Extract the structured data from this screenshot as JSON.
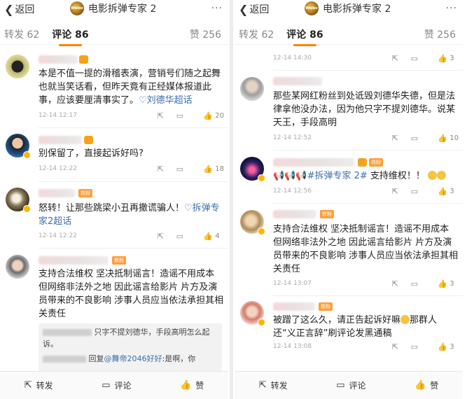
{
  "nav": {
    "back_label": "返回",
    "title": "电影拆弹专家 2"
  },
  "tabs": {
    "repost": "转发 62",
    "comment": "评论 86",
    "likes": "赞 256"
  },
  "bottom_bar": {
    "repost": "转发",
    "comment": "评论",
    "like": "赞"
  },
  "left": {
    "comments": [
      {
        "text": "本是不值一提的滑稽表演，营销号们随之起舞也就当笑话看，但昨天竟有正经媒体报道此事，应该要厘清事实了。",
        "topic": "刘德华超话",
        "time": "12-14 12:17",
        "likes": "20"
      },
      {
        "text": "别保留了，直接起诉好吗?",
        "time": "12-14 12:22",
        "likes": "18"
      },
      {
        "text": "怒转！让那些跳梁小丑再撒谎骗人！",
        "topic": "拆弹专家2超话",
        "time": "12-14 12:22",
        "likes": "4",
        "tag": "铁粉"
      },
      {
        "text": "支持合法维权 坚决抵制谣言！造谣不用成本 但网络非法外之地 因此谣言给影片 片方及演员带来的不良影响 涉事人员应当依法承担其相关责任",
        "tag": "铁粉"
      }
    ],
    "reply1": "只字不提刘德华，手段高明怎么起诉。",
    "reply2_prefix": "回复",
    "reply2_link": "@舞帝2046好好",
    "reply2_text": ":是啊，你"
  },
  "right": {
    "top_time": "12-14 14:30",
    "top_likes": "3",
    "comments": [
      {
        "text": "那些某网红粉丝到处诋毁刘德华失德，但是法律拿他没办法，因为他只字不提刘德华。说某天王，手段高明",
        "time": "12-14 12:52",
        "likes": "10"
      },
      {
        "text_prefix": "📢📢📢",
        "topic": "#拆弹专家 2#",
        "text": "支持维权！！",
        "time": "12-14 12:56",
        "likes": "3",
        "tag": "铁粉"
      },
      {
        "text": "支持合法维权 坚决抵制谣言！造谣不用成本 但网络非法外之地 因此谣言给影片 片方及演员带来的不良影响 涉事人员应当依法承担其相关责任",
        "time": "12-14 13:07",
        "likes": "3",
        "tag": "铁粉"
      },
      {
        "text_prefix": "被蹭了这么久，请正告起诉好嘛",
        "text": "那群人还“义正言辞”刷评论发黑通稿",
        "time": "12-14 13:08",
        "likes": "3",
        "tag": "铁粉"
      }
    ]
  },
  "colors": {
    "accent": "#ff8200",
    "link": "#3a6fb0",
    "badge": "#f7a21b"
  }
}
